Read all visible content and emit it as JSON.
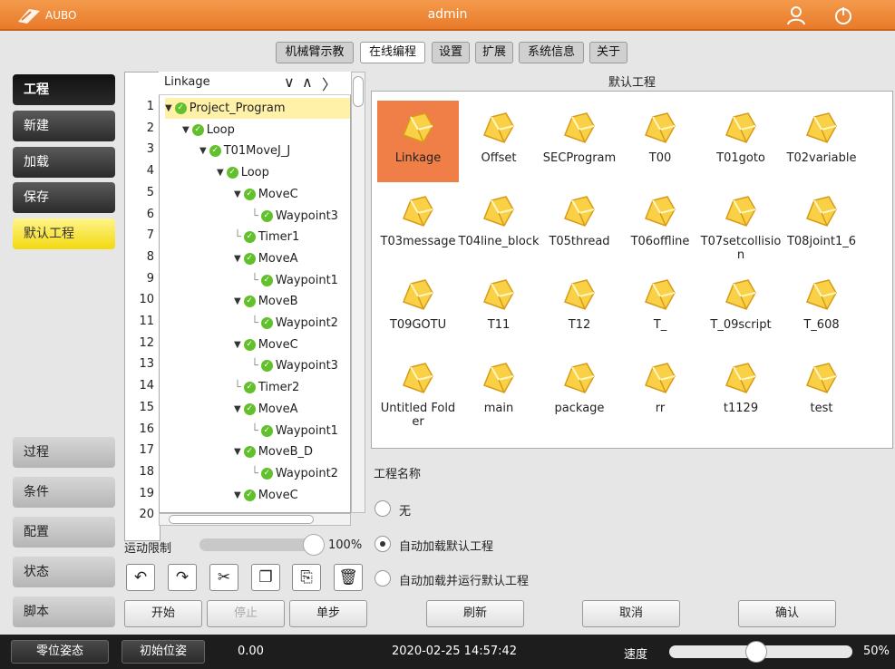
{
  "header": {
    "logo": "AUBO",
    "title": "admin"
  },
  "tabs": [
    {
      "label": "机械臂示教"
    },
    {
      "label": "在线编程"
    },
    {
      "label": "设置"
    },
    {
      "label": "扩展"
    },
    {
      "label": "系统信息"
    },
    {
      "label": "关于"
    }
  ],
  "sidebar": {
    "top": [
      "工程",
      "新建",
      "加载",
      "保存",
      "默认工程"
    ],
    "bottom": [
      "过程",
      "条件",
      "配置",
      "状态",
      "脚本"
    ]
  },
  "tree": {
    "header": "Linkage",
    "line_numbers": [
      "1",
      "2",
      "3",
      "4",
      "5",
      "6",
      "7",
      "8",
      "9",
      "10",
      "11",
      "12",
      "13",
      "14",
      "15",
      "16",
      "17",
      "18",
      "19",
      "20"
    ],
    "rows": [
      "Project_Program",
      "Loop",
      "T01MoveJ_J",
      "Loop",
      "MoveC",
      "Waypoint3",
      "Timer1",
      "MoveA",
      "Waypoint1",
      "MoveB",
      "Waypoint2",
      "MoveC",
      "Waypoint3",
      "Timer2",
      "MoveA",
      "Waypoint1",
      "MoveB_D",
      "Waypoint2",
      "MoveC"
    ]
  },
  "speed_limit": {
    "label": "运动限制",
    "value_text": "100%",
    "level": 1.0
  },
  "projects": {
    "title": "默认工程",
    "items": [
      "Linkage",
      "Offset",
      "SECProgram",
      "T00",
      "T01goto",
      "T02variable",
      "T03message",
      "T04line_block",
      "T05thread",
      "T06offline",
      "T07setcollision",
      "T08joint1_6",
      "T09GOTU",
      "T11",
      "T12",
      "T_",
      "T_09script",
      "T_608",
      "Untitled Folder",
      "main",
      "package",
      "rr",
      "t1129",
      "test"
    ],
    "selected": "Linkage"
  },
  "project_name_label": "工程名称",
  "options": [
    {
      "label": "无",
      "checked": false
    },
    {
      "label": "自动加载默认工程",
      "checked": true
    },
    {
      "label": "自动加载并运行默认工程",
      "checked": false
    }
  ],
  "toolbar_icons": [
    "undo-icon",
    "redo-icon",
    "cut-icon",
    "copy-icon",
    "paste-icon",
    "delete-icon"
  ],
  "run_buttons": {
    "start": "开始",
    "stop": "停止",
    "step": "单步"
  },
  "action_buttons": {
    "refresh": "刷新",
    "cancel": "取消",
    "confirm": "确认"
  },
  "footer": {
    "zero_pose": "零位姿态",
    "init_pose": "初始位姿",
    "value": "0.00",
    "datetime": "2020-02-25 14:57:42",
    "speed_label": "速度",
    "speed_text": "50%",
    "speed_level": 0.5
  },
  "colors": {
    "accent": "#e87b2a",
    "selected": "#f07f47",
    "active_sidebar": "#f2d90f",
    "check": "#62c02c"
  }
}
